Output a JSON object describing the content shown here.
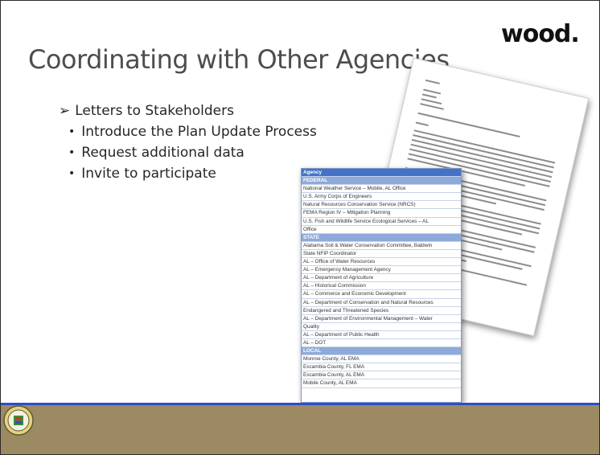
{
  "logo": {
    "text": "wood",
    "dot": "."
  },
  "title": "Coordinating with Other Agencies",
  "bullets": {
    "main": "Letters to Stakeholders",
    "sub": [
      "Introduce the Plan Update Process",
      "Request additional data",
      "Invite to participate"
    ]
  },
  "table": {
    "header": "Agency",
    "rows": [
      {
        "text": "FEDERAL",
        "type": "sec"
      },
      {
        "text": "National Weather Service – Mobile, AL Office",
        "type": "row"
      },
      {
        "text": "U.S. Army Corps of Engineers",
        "type": "row"
      },
      {
        "text": "Natural Resources Conservation Service (NRCS)",
        "type": "row"
      },
      {
        "text": "FEMA Region IV – Mitigation Planning",
        "type": "row"
      },
      {
        "text": "U.S. Fish and Wildlife Service Ecological Services – AL",
        "type": "row"
      },
      {
        "text": "Office",
        "type": "row"
      },
      {
        "text": "STATE",
        "type": "sec"
      },
      {
        "text": "Alabama Soil & Water Conservation Committee, Baldwin",
        "type": "row"
      },
      {
        "text": "State NFIP Coordinator",
        "type": "row"
      },
      {
        "text": "AL – Office of Water Resources",
        "type": "row"
      },
      {
        "text": "AL – Emergency Management Agency",
        "type": "row"
      },
      {
        "text": "AL – Department of Agriculture",
        "type": "row"
      },
      {
        "text": "AL – Historical Commission",
        "type": "row"
      },
      {
        "text": "AL – Commerce and Economic Development",
        "type": "row"
      },
      {
        "text": "AL – Department of Conservation and Natural Resources",
        "type": "row"
      },
      {
        "text": "Endangered and Threatened Species",
        "type": "row"
      },
      {
        "text": "AL – Department of Environmental Management – Water",
        "type": "row"
      },
      {
        "text": "Quality",
        "type": "row"
      },
      {
        "text": "AL – Department of Public Health",
        "type": "row"
      },
      {
        "text": "AL – DOT",
        "type": "row"
      },
      {
        "text": "LOCAL",
        "type": "sec"
      },
      {
        "text": "Monroe County, AL EMA",
        "type": "row"
      },
      {
        "text": "Escambia County, FL EMA",
        "type": "row"
      },
      {
        "text": "Escambia County, AL EMA",
        "type": "row"
      },
      {
        "text": "Mobile County, AL EMA",
        "type": "row"
      }
    ]
  },
  "colors": {
    "title": "#4d4d4d",
    "table_header": "#4472c4",
    "table_section": "#8eaadb",
    "footer": "#9c8a63",
    "footer_line": "#2d4fc4"
  }
}
